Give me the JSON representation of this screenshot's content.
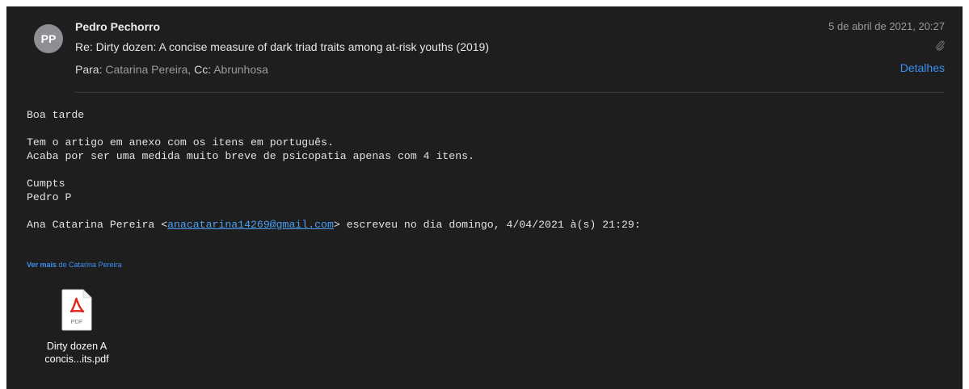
{
  "header": {
    "avatar_initials": "PP",
    "sender": "Pedro Pechorro",
    "subject": "Re: Dirty dozen: A concise measure of dark triad traits among at-risk youths (2019)",
    "to_label": "Para:",
    "to_value": "Catarina Pereira,",
    "cc_label": "Cc:",
    "cc_value": "Abrunhosa",
    "date": "5 de abril de 2021, 20:27",
    "details_label": "Detalhes"
  },
  "body": {
    "greeting": "Boa tarde",
    "line1": "Tem o artigo em anexo com os itens em português.",
    "line2": "Acaba por ser uma medida muito breve de psicopatia apenas com 4 itens.",
    "signoff": "Cumpts",
    "signature": "Pedro P",
    "quote_prefix": "Ana Catarina Pereira <",
    "quote_email": "anacatarina14269@gmail.com",
    "quote_suffix": "> escreveu no dia domingo, 4/04/2021 à(s) 21:29:"
  },
  "see_more": {
    "link": "Ver mais",
    "rest": " de Catarina Pereira"
  },
  "attachment": {
    "icon_text": "PDF",
    "name_line1": "Dirty dozen A",
    "name_line2": "concis...its.pdf"
  },
  "colors": {
    "background": "#1e1e1e",
    "accent": "#3b8ff1",
    "pdf_red": "#e0261f"
  },
  "icons": {
    "attachment": "paperclip-icon",
    "file": "pdf-file-icon"
  }
}
